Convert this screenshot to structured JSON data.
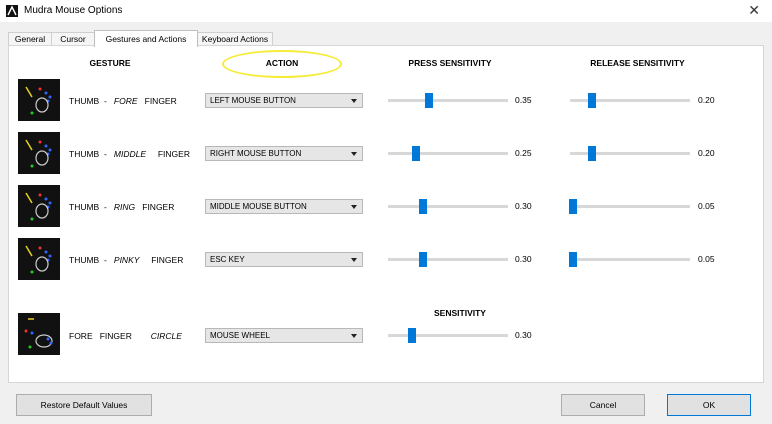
{
  "window": {
    "title": "Mudra Mouse Options",
    "close_icon": "close-icon",
    "app_icon": "mudra-app-icon"
  },
  "tabs": [
    {
      "label": "General",
      "active": false
    },
    {
      "label": "Cursor",
      "active": false
    },
    {
      "label": "Gestures and Actions",
      "active": true
    },
    {
      "label": "Keyboard Actions",
      "active": false
    }
  ],
  "headers": {
    "gesture": "GESTURE",
    "action": "ACTION",
    "press_sensitivity": "PRESS SENSITIVITY",
    "release_sensitivity": "RELEASE SENSITIVITY",
    "sensitivity": "SENSITIVITY"
  },
  "colors": {
    "slider_accent": "#0078d7",
    "annotation_circle": "#f5ec3a"
  },
  "rows": [
    {
      "a": "THUMB",
      "dash": "-",
      "b": "FORE",
      "c": "FINGER",
      "action": "LEFT MOUSE BUTTON",
      "press": "0.35",
      "press_level": 0.35,
      "release": "0.20",
      "release_level": 0.2
    },
    {
      "a": "THUMB",
      "dash": "-",
      "b": "MIDDLE",
      "c": "FINGER",
      "action": "RIGHT MOUSE BUTTON",
      "press": "0.25",
      "press_level": 0.25,
      "release": "0.20",
      "release_level": 0.2
    },
    {
      "a": "THUMB",
      "dash": "-",
      "b": "RING",
      "c": "FINGER",
      "action": "MIDDLE MOUSE BUTTON",
      "press": "0.30",
      "press_level": 0.3,
      "release": "0.05",
      "release_level": 0.05
    },
    {
      "a": "THUMB",
      "dash": "-",
      "b": "PINKY",
      "c": "FINGER",
      "action": "ESC KEY",
      "press": "0.30",
      "press_level": 0.3,
      "release": "0.05",
      "release_level": 0.05
    }
  ],
  "circle_row": {
    "a": "FORE",
    "b": "FINGER",
    "c": "CIRCLE",
    "action": "MOUSE WHEEL",
    "sensitivity": "0.30",
    "sensitivity_level": 0.3
  },
  "buttons": {
    "restore": "Restore Default Values",
    "cancel": "Cancel",
    "ok": "OK"
  }
}
